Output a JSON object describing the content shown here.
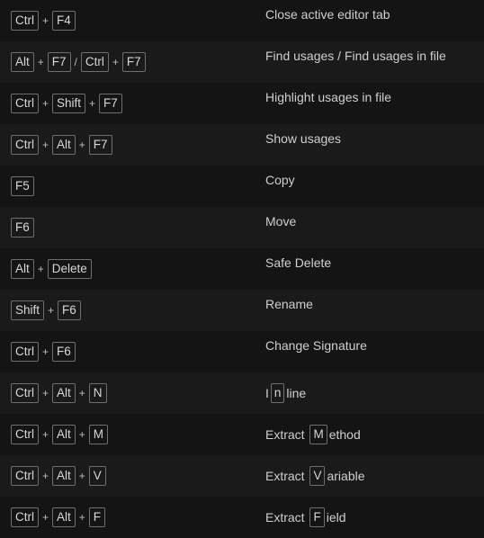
{
  "shortcuts": [
    {
      "keys": [
        [
          "Ctrl",
          "F4"
        ]
      ],
      "desc": "Close active editor tab"
    },
    {
      "keys": [
        [
          "Alt",
          "F7"
        ],
        [
          "Ctrl",
          "F7"
        ]
      ],
      "desc": "Find usages / Find usages in file"
    },
    {
      "keys": [
        [
          "Ctrl",
          "Shift",
          "F7"
        ]
      ],
      "desc": "Highlight usages in file"
    },
    {
      "keys": [
        [
          "Ctrl",
          "Alt",
          "F7"
        ]
      ],
      "desc": "Show usages"
    },
    {
      "keys": [
        [
          "F5"
        ]
      ],
      "desc": "Copy"
    },
    {
      "keys": [
        [
          "F6"
        ]
      ],
      "desc": "Move"
    },
    {
      "keys": [
        [
          "Alt",
          "Delete"
        ]
      ],
      "desc": "Safe Delete"
    },
    {
      "keys": [
        [
          "Shift",
          "F6"
        ]
      ],
      "desc": "Rename"
    },
    {
      "keys": [
        [
          "Ctrl",
          "F6"
        ]
      ],
      "desc": "Change Signature"
    },
    {
      "keys": [
        [
          "Ctrl",
          "Alt",
          "N"
        ]
      ],
      "desc_parts": [
        "I",
        "n",
        "line"
      ]
    },
    {
      "keys": [
        [
          "Ctrl",
          "Alt",
          "M"
        ]
      ],
      "desc_parts": [
        "Extract ",
        "M",
        "ethod"
      ]
    },
    {
      "keys": [
        [
          "Ctrl",
          "Alt",
          "V"
        ]
      ],
      "desc_parts": [
        "Extract ",
        "V",
        "ariable"
      ]
    },
    {
      "keys": [
        [
          "Ctrl",
          "Alt",
          "F"
        ]
      ],
      "desc_parts": [
        "Extract ",
        "F",
        "ield"
      ]
    }
  ],
  "symbols": {
    "plus": "+",
    "alt_separator": "/"
  }
}
